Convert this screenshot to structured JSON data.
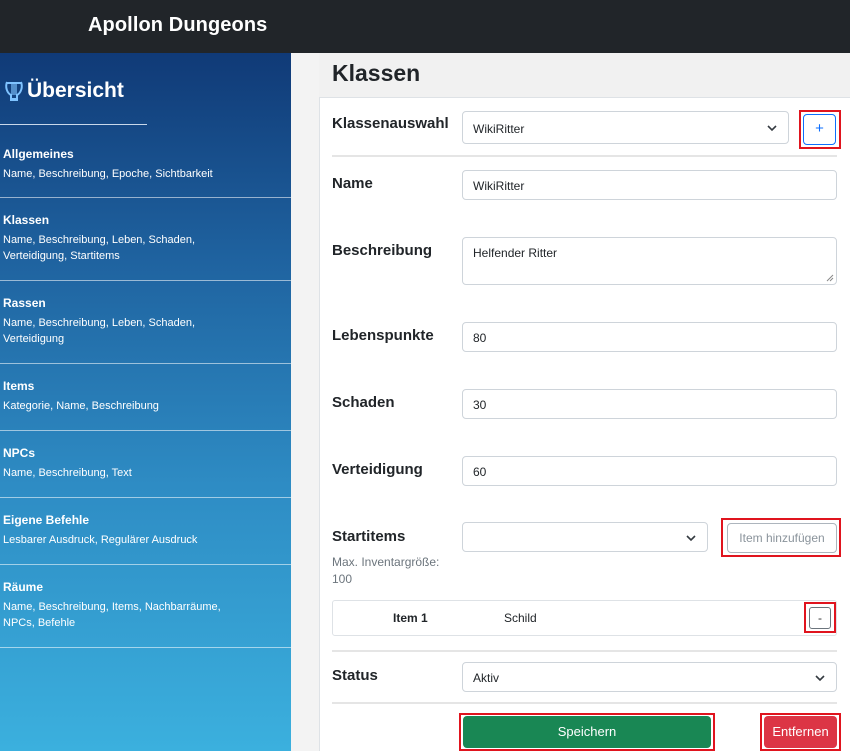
{
  "app": {
    "title": "Apollon Dungeons"
  },
  "sidebar": {
    "heading": "Übersicht",
    "heading_icon": "lyre-icon",
    "items": [
      {
        "title": "Allgemeines",
        "desc": "Name, Beschreibung, Epoche, Sichtbarkeit"
      },
      {
        "title": "Klassen",
        "desc": "Name, Beschreibung, Leben, Schaden, Verteidigung, Startitems"
      },
      {
        "title": "Rassen",
        "desc": "Name, Beschreibung, Leben, Schaden, Verteidigung"
      },
      {
        "title": "Items",
        "desc": "Kategorie, Name, Beschreibung"
      },
      {
        "title": "NPCs",
        "desc": "Name, Beschreibung, Text"
      },
      {
        "title": "Eigene Befehle",
        "desc": "Lesbarer Ausdruck, Regulärer Ausdruck"
      },
      {
        "title": "Räume",
        "desc": "Name, Beschreibung, Items, Nachbarräume, NPCs, Befehle"
      }
    ]
  },
  "page": {
    "title": "Klassen"
  },
  "form": {
    "class_select": {
      "label": "Klassenauswahl",
      "value": "WikiRitter",
      "add_label": "+"
    },
    "name": {
      "label": "Name",
      "value": "WikiRitter"
    },
    "description": {
      "label": "Beschreibung",
      "value": "Helfender Ritter"
    },
    "health": {
      "label": "Lebenspunkte",
      "value": "80"
    },
    "damage": {
      "label": "Schaden",
      "value": "30"
    },
    "defense": {
      "label": "Verteidigung",
      "value": "60"
    },
    "start_items": {
      "label": "Startitems",
      "hint": "Max. Inventargröße: 100",
      "select_value": "",
      "add_item_label": "Item hinzufügen",
      "items": [
        {
          "key": "Item 1",
          "value": "Schild",
          "remove_label": "-"
        }
      ]
    },
    "status": {
      "label": "Status",
      "value": "Aktiv"
    },
    "save_label": "Speichern",
    "remove_label": "Entfernen"
  },
  "colors": {
    "topbar": "#212529",
    "save": "#198754",
    "remove": "#dc3545",
    "highlight": "#e0141e",
    "primary": "#0d6efd"
  }
}
